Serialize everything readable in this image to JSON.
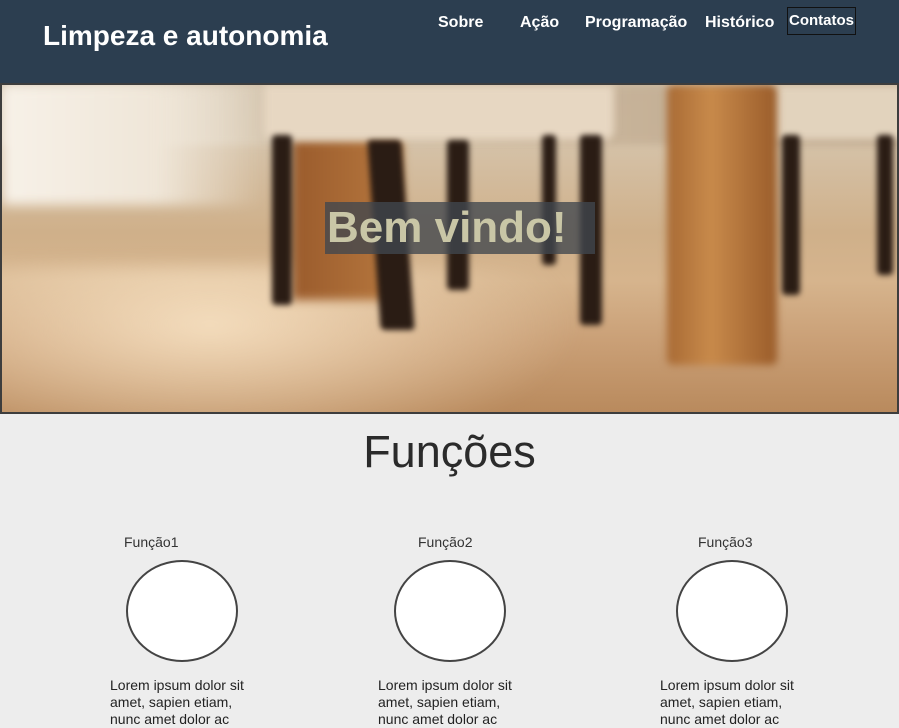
{
  "header": {
    "title": "Limpeza e autonomia",
    "nav": [
      "Sobre",
      "Ação",
      "Programação",
      "Histórico",
      "Contatos"
    ],
    "background_color": "#2c3e50"
  },
  "hero": {
    "welcome_text": "Bem vindo!"
  },
  "functions": {
    "title": "Funções",
    "items": [
      {
        "label": "Função1",
        "text": "Lorem ipsum dolor sit amet, sapien etiam, nunc amet dolor ac"
      },
      {
        "label": "Função2",
        "text": "Lorem ipsum dolor sit amet, sapien etiam, nunc amet dolor ac"
      },
      {
        "label": "Função3",
        "text": "Lorem ipsum dolor sit amet, sapien etiam, nunc amet dolor ac"
      }
    ]
  }
}
